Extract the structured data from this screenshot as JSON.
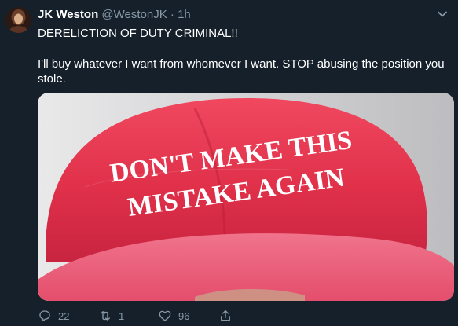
{
  "tweet": {
    "author_name": "JK Weston",
    "author_handle": "@WestonJK",
    "separator": "·",
    "time": "1h",
    "text_line1": "DERELICTION OF DUTY CRIMINAL!!",
    "text_line2": "I'll buy whatever I want from whomever I want. STOP abusing the position you stole.",
    "media": {
      "hat_text_line1": "DON'T MAKE THIS",
      "hat_text_line2": "MISTAKE AGAIN",
      "hat_color": "#e0304a"
    }
  },
  "actions": {
    "reply_count": "22",
    "retweet_count": "1",
    "like_count": "96"
  },
  "colors": {
    "background": "#15202b",
    "secondary_text": "#8899a6",
    "primary_text": "#ffffff"
  }
}
